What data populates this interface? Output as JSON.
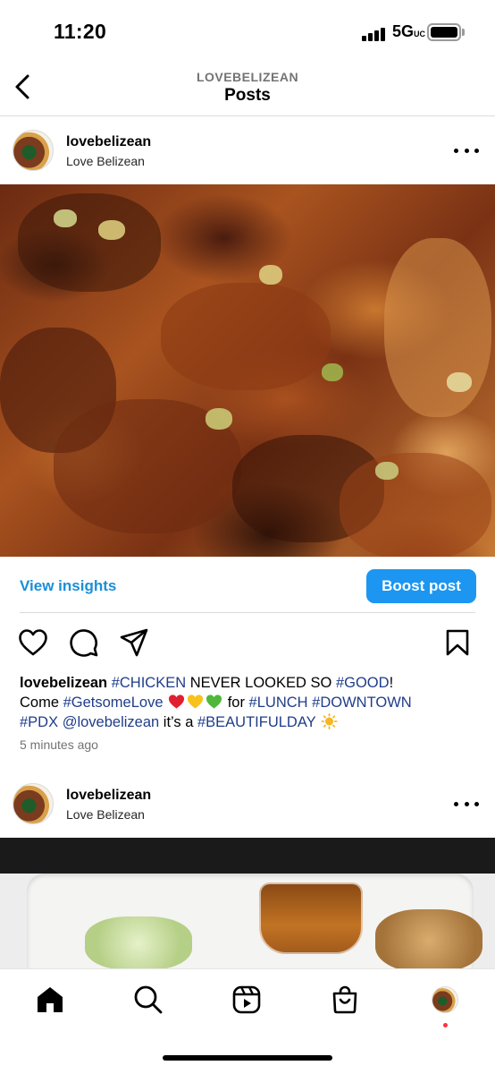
{
  "status_bar": {
    "time": "11:20",
    "network": "5G",
    "network_suffix": "UC"
  },
  "header": {
    "subtitle": "LOVEBELIZEAN",
    "title": "Posts"
  },
  "posts": [
    {
      "username": "lovebelizean",
      "display_name": "Love Belizean",
      "image_icon": "grilled-chicken-photo",
      "view_insights": "View insights",
      "boost_label": "Boost post",
      "caption": {
        "user": "lovebelizean",
        "tag1": "#CHICKEN",
        "t1": " NEVER LOOKED SO ",
        "tag2": "#GOOD",
        "t2": "!",
        "t3": "Come ",
        "tag3": "#GetsomeLove",
        "t4": " for ",
        "tag4": "#LUNCH",
        "tag5": "#DOWNTOWN",
        "tag6": "#PDX",
        "tag7": "@lovebelizean",
        "t5": " it’s a ",
        "tag8": "#BEAUTIFULDAY"
      },
      "timestamp": "5 minutes ago"
    },
    {
      "username": "lovebelizean",
      "display_name": "Love Belizean",
      "image_icon": "takeout-box-photo"
    }
  ],
  "bottom_nav": [
    "home-icon",
    "search-icon",
    "reels-icon",
    "shop-icon",
    "profile-avatar"
  ],
  "colors": {
    "accent": "#1c96f0",
    "link": "#1a8fd8",
    "hashtag": "#1f3d8a",
    "notification": "#ff3040"
  }
}
